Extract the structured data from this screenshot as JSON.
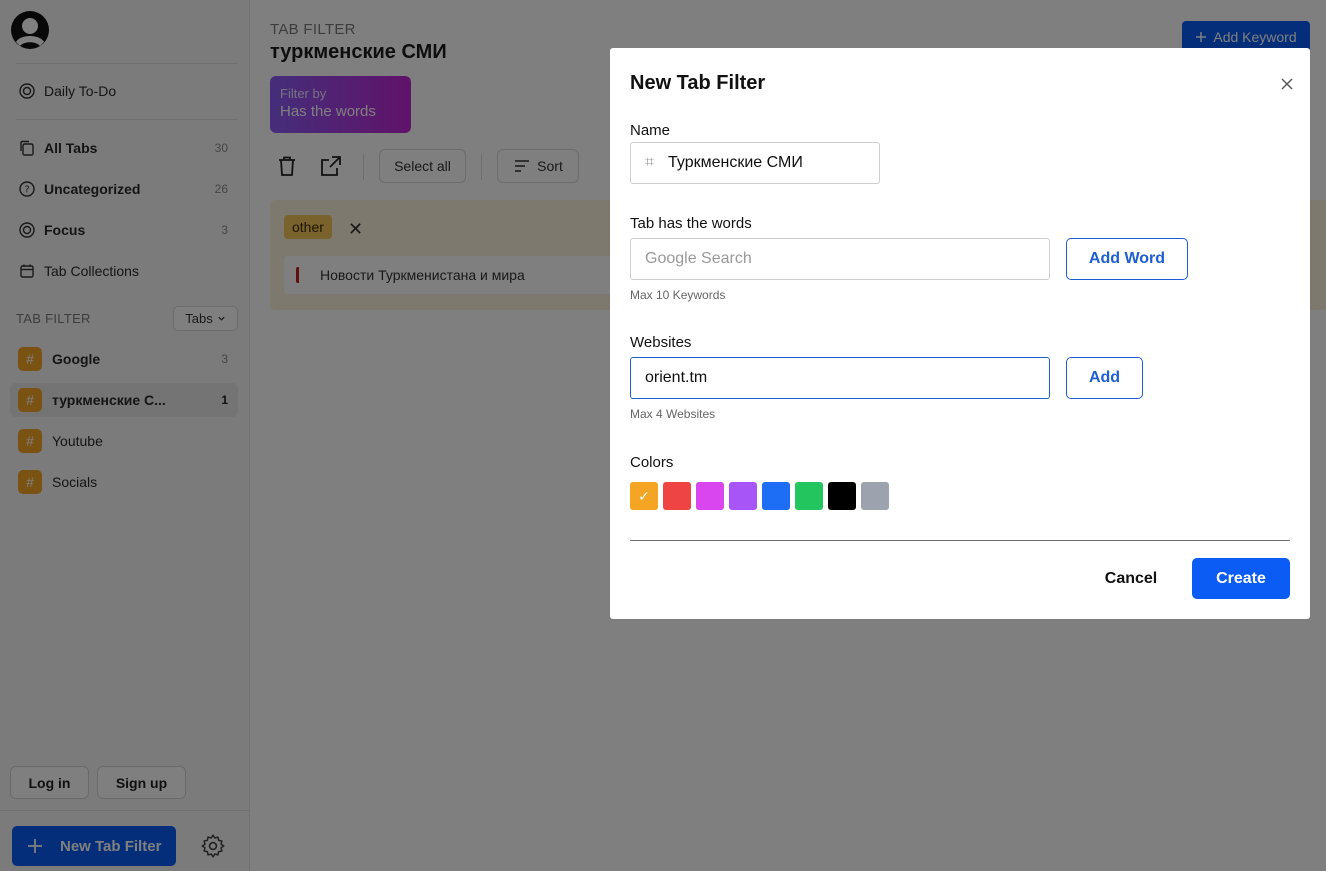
{
  "sidebar": {
    "logo_icon": "avatar-logo-icon",
    "items": [
      {
        "label": "Daily To-Do",
        "icon": "target-icon",
        "count": ""
      },
      {
        "label": "All Tabs",
        "icon": "copy-icon",
        "count": "30"
      },
      {
        "label": "Uncategorized",
        "icon": "question-circle-icon",
        "count": "26"
      },
      {
        "label": "Focus",
        "icon": "target-icon",
        "count": "3"
      },
      {
        "label": "Tab Collections",
        "icon": "calendar-icon",
        "count": ""
      }
    ],
    "tab_filter_title": "TAB FILTER",
    "tabs_select": "Tabs",
    "filters": [
      {
        "label": "Google",
        "count": "3"
      },
      {
        "label": "туркменские С...",
        "count": "1"
      },
      {
        "label": "Youtube",
        "count": ""
      },
      {
        "label": "Socials",
        "count": ""
      }
    ],
    "login_label": "Log in",
    "signup_label": "Sign up",
    "new_filter_label": "New Tab Filter",
    "accent_color": "#f5a524"
  },
  "main": {
    "eyebrow": "TAB FILTER",
    "title": "туркменские СМИ",
    "filter_by_label": "Filter by",
    "filter_by_value": "Has the words",
    "add_keyword_label": "Add Keyword",
    "toolbar": {
      "select_all": "Select all",
      "sort": "Sort"
    },
    "group": {
      "tag": "other",
      "tabs": [
        {
          "title": "Новости Туркменистана и мира"
        }
      ]
    }
  },
  "modal": {
    "title": "New Tab Filter",
    "name_label": "Name",
    "name_value": "Туркменские СМИ",
    "words_label": "Tab has the words",
    "words_placeholder": "Google Search",
    "add_word_label": "Add Word",
    "words_hint": "Max 10 Keywords",
    "websites_label": "Websites",
    "websites_value": "orient.tm",
    "add_site_label": "Add",
    "websites_hint": "Max 4 Websites",
    "colors_label": "Colors",
    "colors": [
      "#f5a524",
      "#ef4444",
      "#d946ef",
      "#a855f7",
      "#1d6ef5",
      "#22c55e",
      "#000000",
      "#9ca3af"
    ],
    "selected_color_index": 0,
    "cancel_label": "Cancel",
    "create_label": "Create",
    "primary_color": "#0a5cf5"
  }
}
